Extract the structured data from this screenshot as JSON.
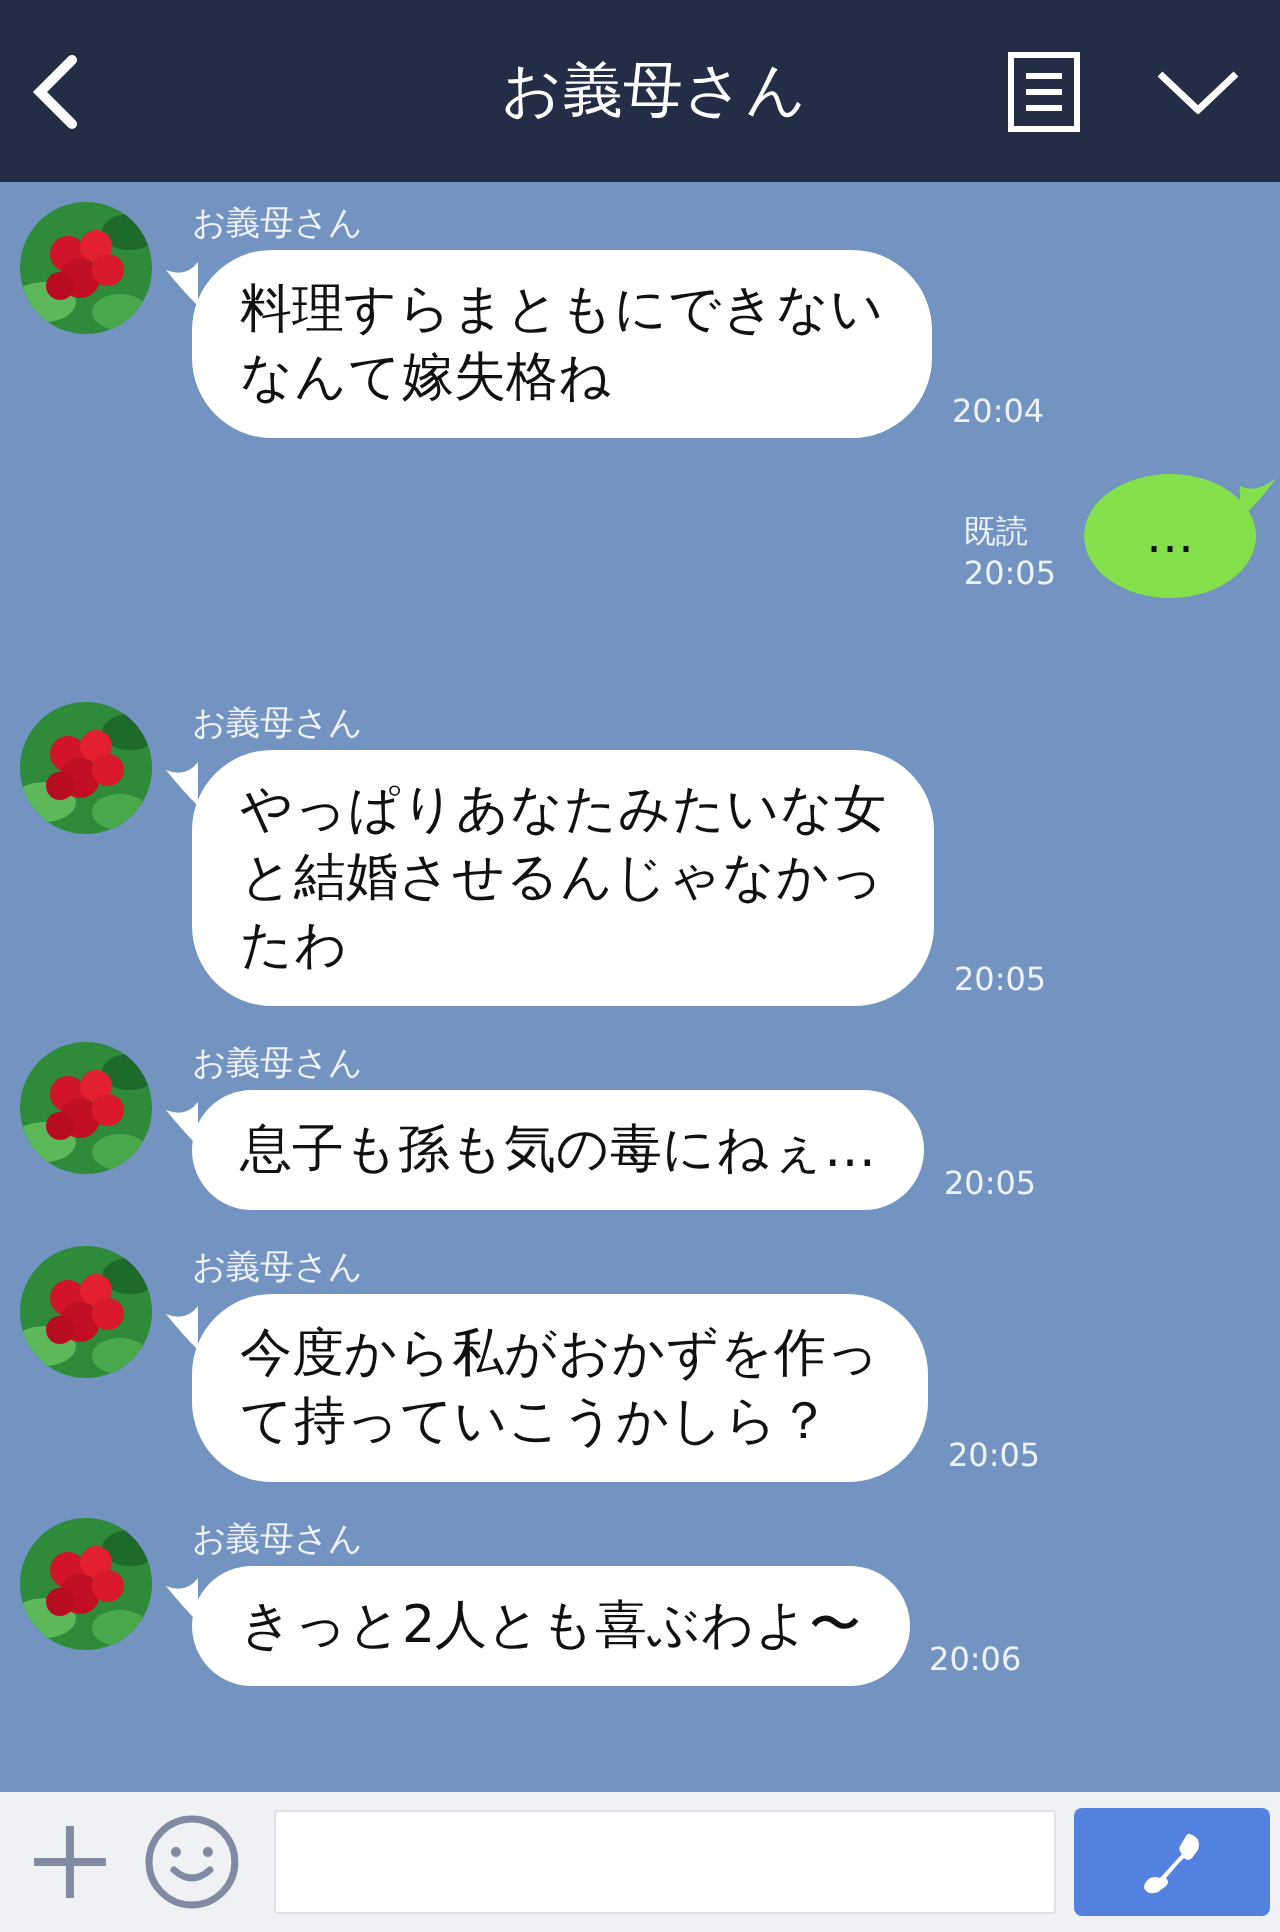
{
  "header": {
    "title": "お義母さん"
  },
  "messages": [
    {
      "kind": "incoming",
      "sender": "お義母さん",
      "lines": [
        "料理すらまともにできない",
        "なんて嫁失格ね"
      ],
      "time": "20:04"
    },
    {
      "kind": "outgoing",
      "text": "…",
      "read": "既読",
      "time": "20:05"
    },
    {
      "kind": "incoming",
      "sender": "お義母さん",
      "lines": [
        "やっぱりあなたみたいな女",
        "と結婚させるんじゃなかっ",
        "たわ"
      ],
      "time": "20:05"
    },
    {
      "kind": "incoming",
      "sender": "お義母さん",
      "lines": [
        "息子も孫も気の毒にねぇ…"
      ],
      "time": "20:05"
    },
    {
      "kind": "incoming",
      "sender": "お義母さん",
      "lines": [
        "今度から私がおかずを作っ",
        "て持っていこうかしら？"
      ],
      "time": "20:05"
    },
    {
      "kind": "incoming",
      "sender": "お義母さん",
      "lines": [
        "きっと2人とも喜ぶわよ〜"
      ],
      "time": "20:06"
    }
  ]
}
